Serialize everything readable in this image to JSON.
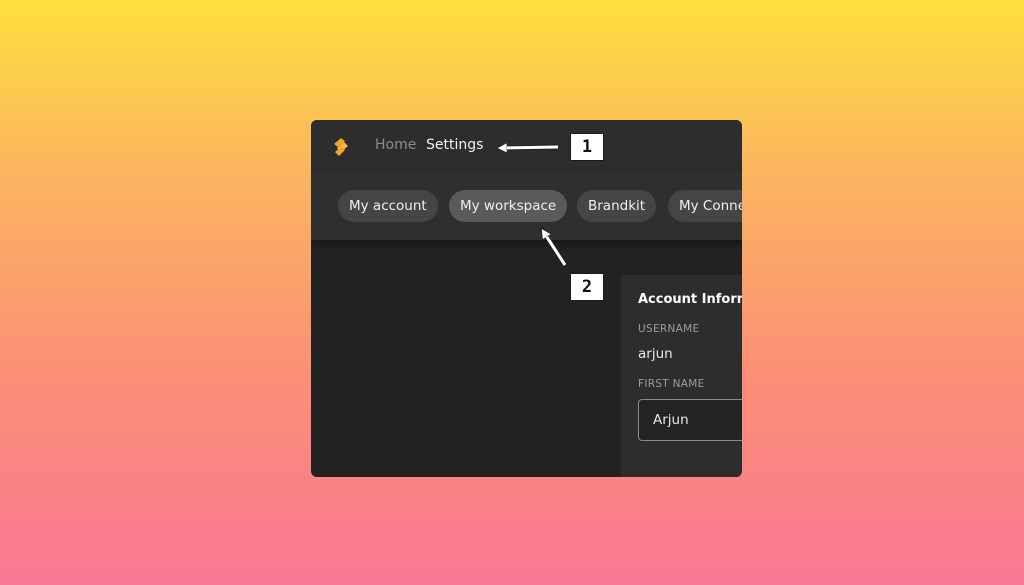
{
  "nav": {
    "home_label": "Home",
    "settings_label": "Settings"
  },
  "tabs": [
    {
      "label": "My account",
      "active": false
    },
    {
      "label": "My workspace",
      "active": true
    },
    {
      "label": "Brandkit",
      "active": false
    },
    {
      "label": "My Conne",
      "active": false
    }
  ],
  "account_card": {
    "title": "Account Inform",
    "username_label": "USERNAME",
    "username_value": "arjun",
    "first_name_label": "FIRST NAME",
    "first_name_value": "Arjun"
  },
  "annotations": [
    {
      "number": "1"
    },
    {
      "number": "2"
    }
  ],
  "colors": {
    "logo_accent": "#f5a623",
    "background_top": "#fde03d",
    "background_bottom": "#f97895"
  },
  "icons": {
    "logo": "app-logo-icon"
  }
}
